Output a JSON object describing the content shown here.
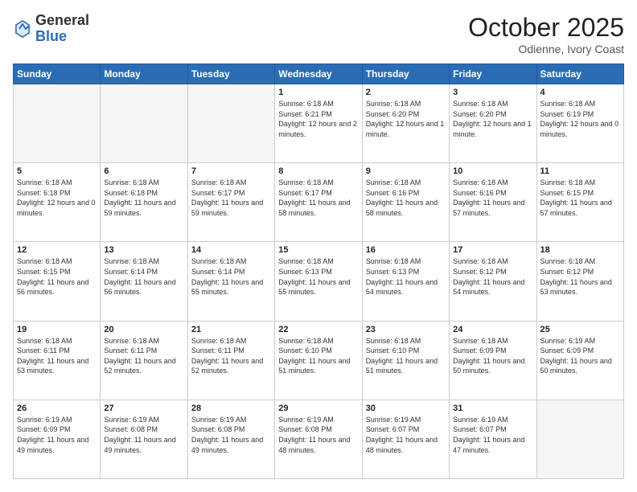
{
  "header": {
    "logo_general": "General",
    "logo_blue": "Blue",
    "month_title": "October 2025",
    "subtitle": "Odienne, Ivory Coast"
  },
  "days_of_week": [
    "Sunday",
    "Monday",
    "Tuesday",
    "Wednesday",
    "Thursday",
    "Friday",
    "Saturday"
  ],
  "weeks": [
    [
      {
        "day": "",
        "info": ""
      },
      {
        "day": "",
        "info": ""
      },
      {
        "day": "",
        "info": ""
      },
      {
        "day": "1",
        "info": "Sunrise: 6:18 AM\nSunset: 6:21 PM\nDaylight: 12 hours\nand 2 minutes."
      },
      {
        "day": "2",
        "info": "Sunrise: 6:18 AM\nSunset: 6:20 PM\nDaylight: 12 hours\nand 1 minute."
      },
      {
        "day": "3",
        "info": "Sunrise: 6:18 AM\nSunset: 6:20 PM\nDaylight: 12 hours\nand 1 minute."
      },
      {
        "day": "4",
        "info": "Sunrise: 6:18 AM\nSunset: 6:19 PM\nDaylight: 12 hours\nand 0 minutes."
      }
    ],
    [
      {
        "day": "5",
        "info": "Sunrise: 6:18 AM\nSunset: 6:18 PM\nDaylight: 12 hours\nand 0 minutes."
      },
      {
        "day": "6",
        "info": "Sunrise: 6:18 AM\nSunset: 6:18 PM\nDaylight: 11 hours\nand 59 minutes."
      },
      {
        "day": "7",
        "info": "Sunrise: 6:18 AM\nSunset: 6:17 PM\nDaylight: 11 hours\nand 59 minutes."
      },
      {
        "day": "8",
        "info": "Sunrise: 6:18 AM\nSunset: 6:17 PM\nDaylight: 11 hours\nand 58 minutes."
      },
      {
        "day": "9",
        "info": "Sunrise: 6:18 AM\nSunset: 6:16 PM\nDaylight: 11 hours\nand 58 minutes."
      },
      {
        "day": "10",
        "info": "Sunrise: 6:18 AM\nSunset: 6:16 PM\nDaylight: 11 hours\nand 57 minutes."
      },
      {
        "day": "11",
        "info": "Sunrise: 6:18 AM\nSunset: 6:15 PM\nDaylight: 11 hours\nand 57 minutes."
      }
    ],
    [
      {
        "day": "12",
        "info": "Sunrise: 6:18 AM\nSunset: 6:15 PM\nDaylight: 11 hours\nand 56 minutes."
      },
      {
        "day": "13",
        "info": "Sunrise: 6:18 AM\nSunset: 6:14 PM\nDaylight: 11 hours\nand 56 minutes."
      },
      {
        "day": "14",
        "info": "Sunrise: 6:18 AM\nSunset: 6:14 PM\nDaylight: 11 hours\nand 55 minutes."
      },
      {
        "day": "15",
        "info": "Sunrise: 6:18 AM\nSunset: 6:13 PM\nDaylight: 11 hours\nand 55 minutes."
      },
      {
        "day": "16",
        "info": "Sunrise: 6:18 AM\nSunset: 6:13 PM\nDaylight: 11 hours\nand 54 minutes."
      },
      {
        "day": "17",
        "info": "Sunrise: 6:18 AM\nSunset: 6:12 PM\nDaylight: 11 hours\nand 54 minutes."
      },
      {
        "day": "18",
        "info": "Sunrise: 6:18 AM\nSunset: 6:12 PM\nDaylight: 11 hours\nand 53 minutes."
      }
    ],
    [
      {
        "day": "19",
        "info": "Sunrise: 6:18 AM\nSunset: 6:11 PM\nDaylight: 11 hours\nand 53 minutes."
      },
      {
        "day": "20",
        "info": "Sunrise: 6:18 AM\nSunset: 6:11 PM\nDaylight: 11 hours\nand 52 minutes."
      },
      {
        "day": "21",
        "info": "Sunrise: 6:18 AM\nSunset: 6:11 PM\nDaylight: 11 hours\nand 52 minutes."
      },
      {
        "day": "22",
        "info": "Sunrise: 6:18 AM\nSunset: 6:10 PM\nDaylight: 11 hours\nand 51 minutes."
      },
      {
        "day": "23",
        "info": "Sunrise: 6:18 AM\nSunset: 6:10 PM\nDaylight: 11 hours\nand 51 minutes."
      },
      {
        "day": "24",
        "info": "Sunrise: 6:18 AM\nSunset: 6:09 PM\nDaylight: 11 hours\nand 50 minutes."
      },
      {
        "day": "25",
        "info": "Sunrise: 6:19 AM\nSunset: 6:09 PM\nDaylight: 11 hours\nand 50 minutes."
      }
    ],
    [
      {
        "day": "26",
        "info": "Sunrise: 6:19 AM\nSunset: 6:09 PM\nDaylight: 11 hours\nand 49 minutes."
      },
      {
        "day": "27",
        "info": "Sunrise: 6:19 AM\nSunset: 6:08 PM\nDaylight: 11 hours\nand 49 minutes."
      },
      {
        "day": "28",
        "info": "Sunrise: 6:19 AM\nSunset: 6:08 PM\nDaylight: 11 hours\nand 49 minutes."
      },
      {
        "day": "29",
        "info": "Sunrise: 6:19 AM\nSunset: 6:08 PM\nDaylight: 11 hours\nand 48 minutes."
      },
      {
        "day": "30",
        "info": "Sunrise: 6:19 AM\nSunset: 6:07 PM\nDaylight: 11 hours\nand 48 minutes."
      },
      {
        "day": "31",
        "info": "Sunrise: 6:19 AM\nSunset: 6:07 PM\nDaylight: 11 hours\nand 47 minutes."
      },
      {
        "day": "",
        "info": ""
      }
    ]
  ]
}
